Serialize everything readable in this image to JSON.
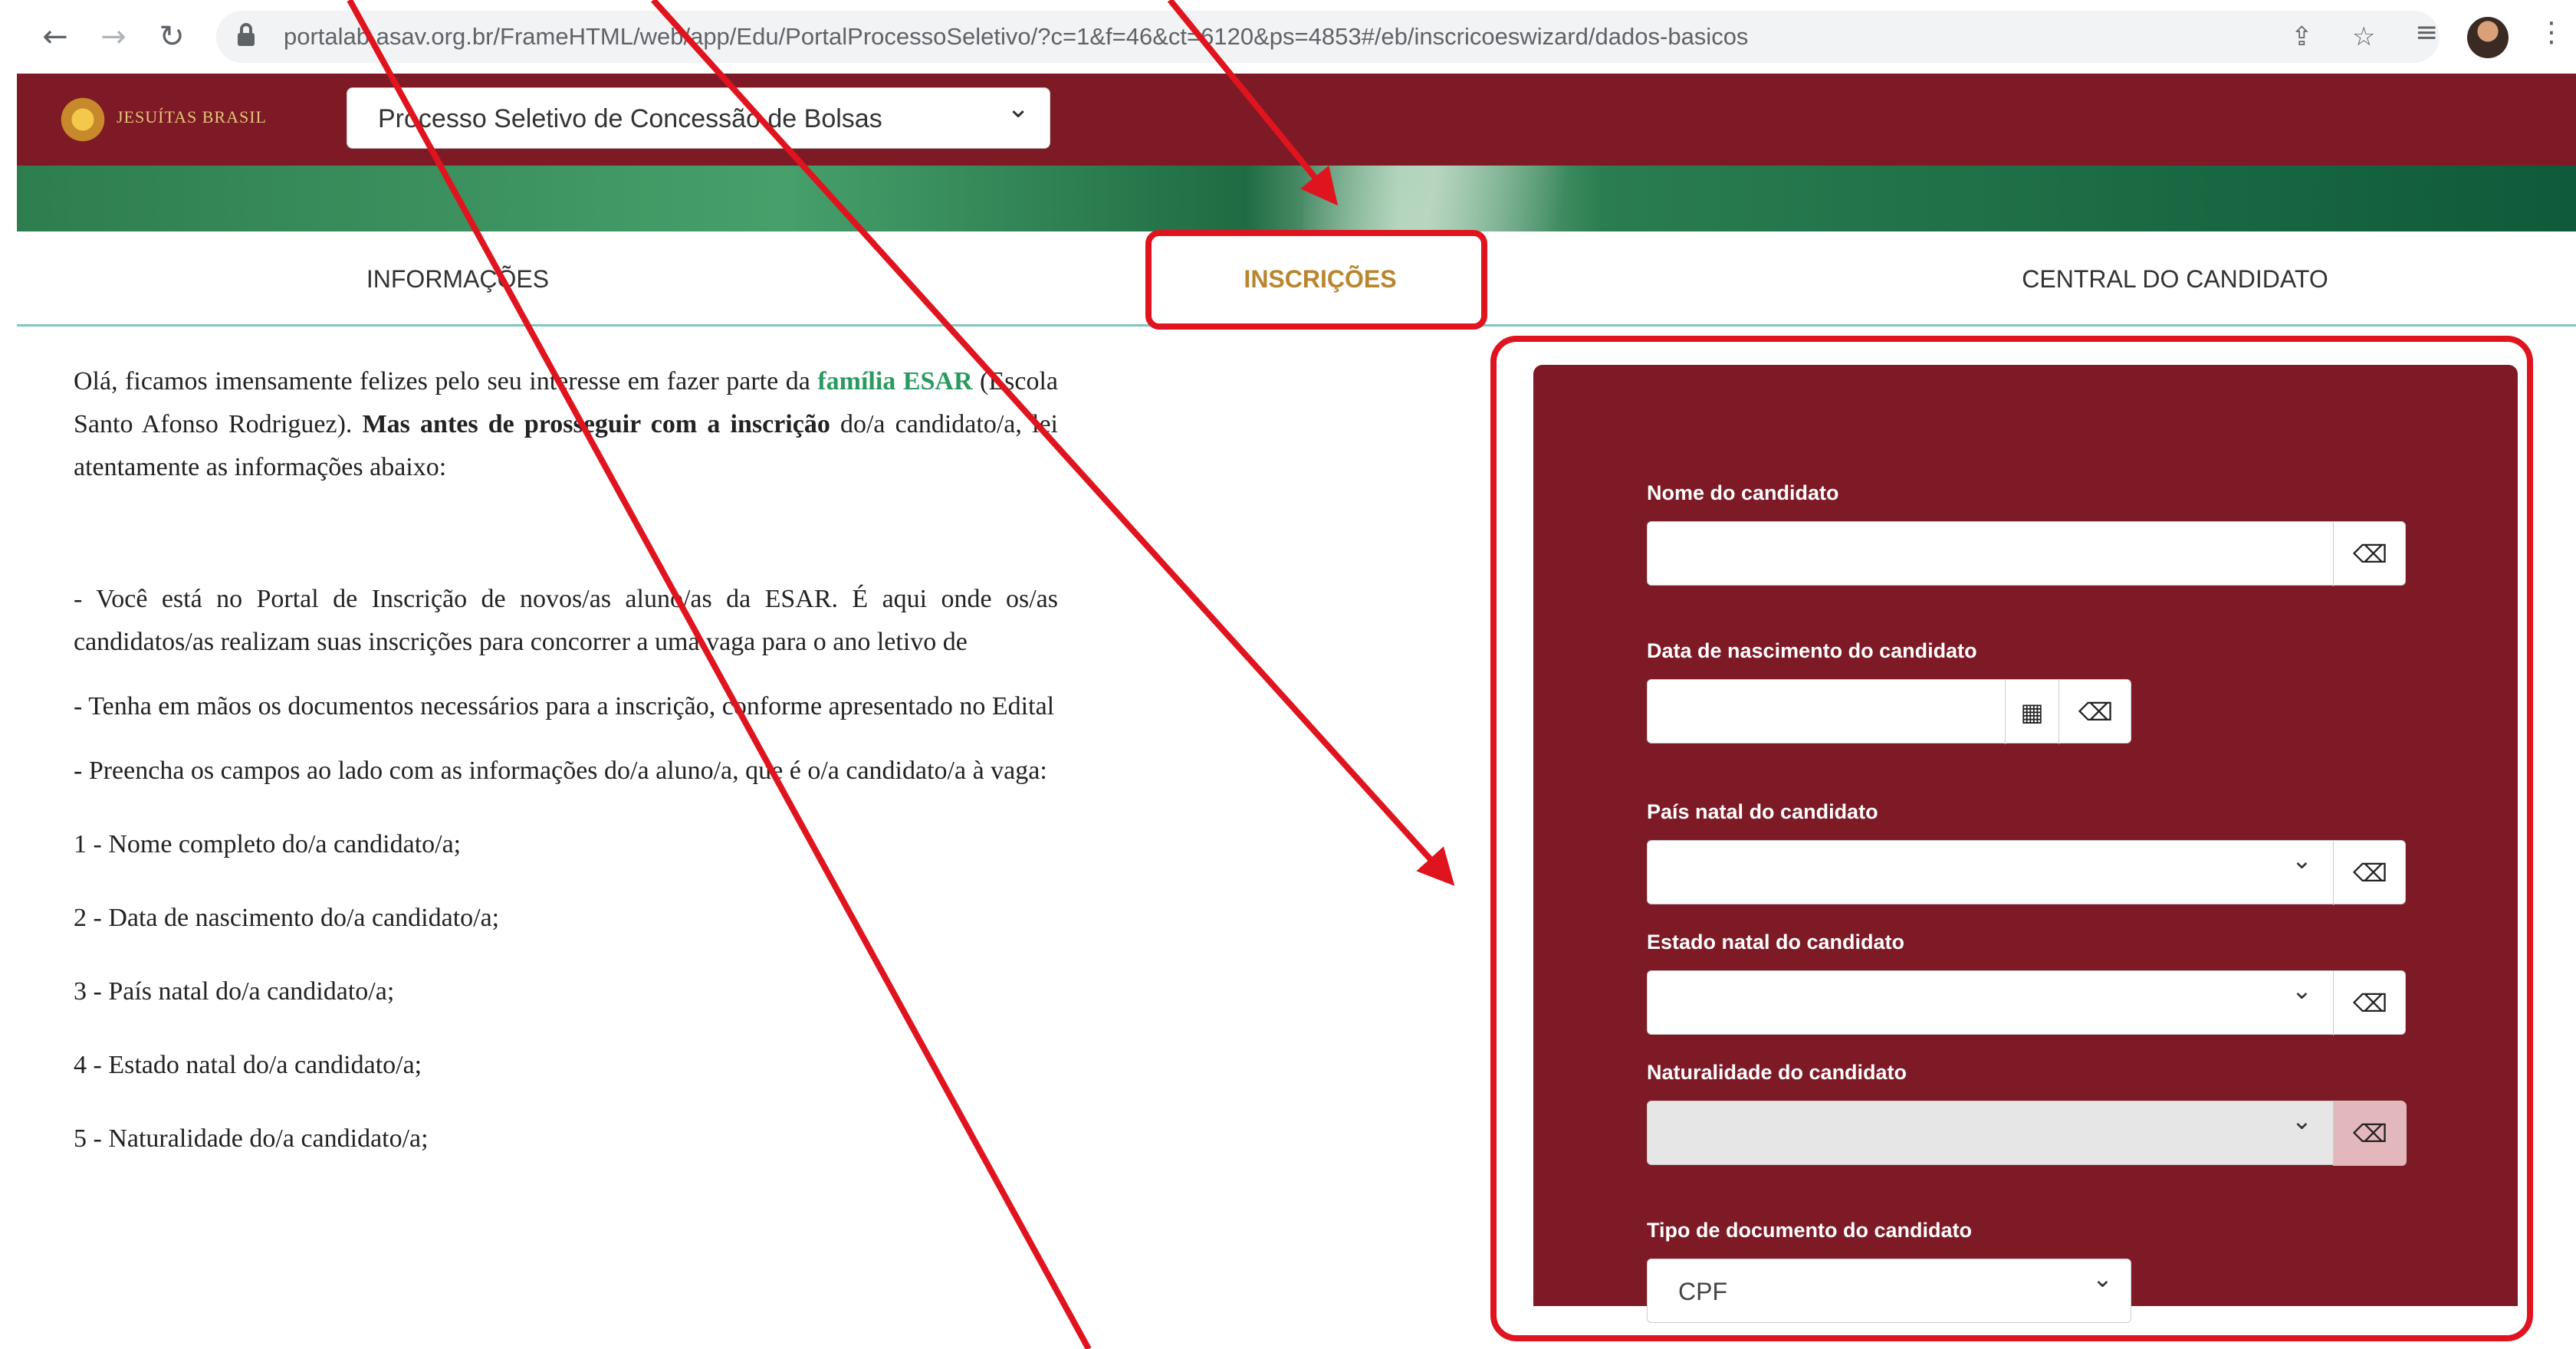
{
  "browser": {
    "back": "←",
    "forward": "→",
    "reload": "↻",
    "url": "portalab.asav.org.br/FrameHTML/web/app/Edu/PortalProcessoSeletivo/?c=1&f=46&ct=6120&ps=4853#/eb/inscricoeswizard/dados-basicos",
    "share_icon": "⇪",
    "bookmark_icon": "☆",
    "reading_list_icon": "≡",
    "menu_icon": "⋮"
  },
  "header": {
    "logo_text": "JESUÍTAS BRASIL",
    "process_select": "Processo Seletivo de Concessão de Bolsas",
    "chevron": "⌄"
  },
  "tabs": [
    {
      "label": "INFORMAÇÕES"
    },
    {
      "label": "INSCRIÇÕES"
    },
    {
      "label": "CENTRAL DO CANDIDATO"
    }
  ],
  "intro": {
    "p1_a": "Olá, ficamos imensamente felizes pelo seu interesse em fazer parte da ",
    "p1_b": "família ESAR",
    "p1_c": " (Escola Santo Afonso Rodriguez). ",
    "p1_d": "Mas antes de prosseguir com a inscrição",
    "p1_e": " do/a candidato/a, lei atentamente as informações abaixo:",
    "p2": "- Você está no Portal de Inscrição de novos/as aluno/as da ESAR. É aqui onde os/as candidatos/as realizam suas inscrições para concorrer a uma vaga para o ano letivo de",
    "p3": "- Tenha em mãos os documentos necessários para a inscrição, conforme apresentado no Edital",
    "p4": "- Preencha os campos ao lado com as informações do/a aluno/a, que é o/a candidato/a à vaga:",
    "items": [
      "1 - Nome completo do/a candidato/a;",
      "2 - Data de nascimento do/a candidato/a;",
      "3 - País natal do/a candidato/a;",
      "4 - Estado natal do/a candidato/a;",
      "5 - Naturalidade do/a candidato/a;"
    ]
  },
  "form": {
    "nome_label": "Nome do candidato",
    "nascimento_label": "Data de nascimento do candidato",
    "pais_label": "País natal do candidato",
    "estado_label": "Estado natal do candidato",
    "naturalidade_label": "Naturalidade do candidato",
    "tipo_doc_label": "Tipo de documento do candidato",
    "tipo_doc_value": "CPF",
    "eraser_icon": "⌫",
    "calendar_icon": "▦",
    "chevron": "⌄"
  },
  "colors": {
    "brand": "#7d1a25",
    "tab_active": "#b8862f",
    "annotation": "#e0141f",
    "accent_green": "#2a9a5e"
  }
}
